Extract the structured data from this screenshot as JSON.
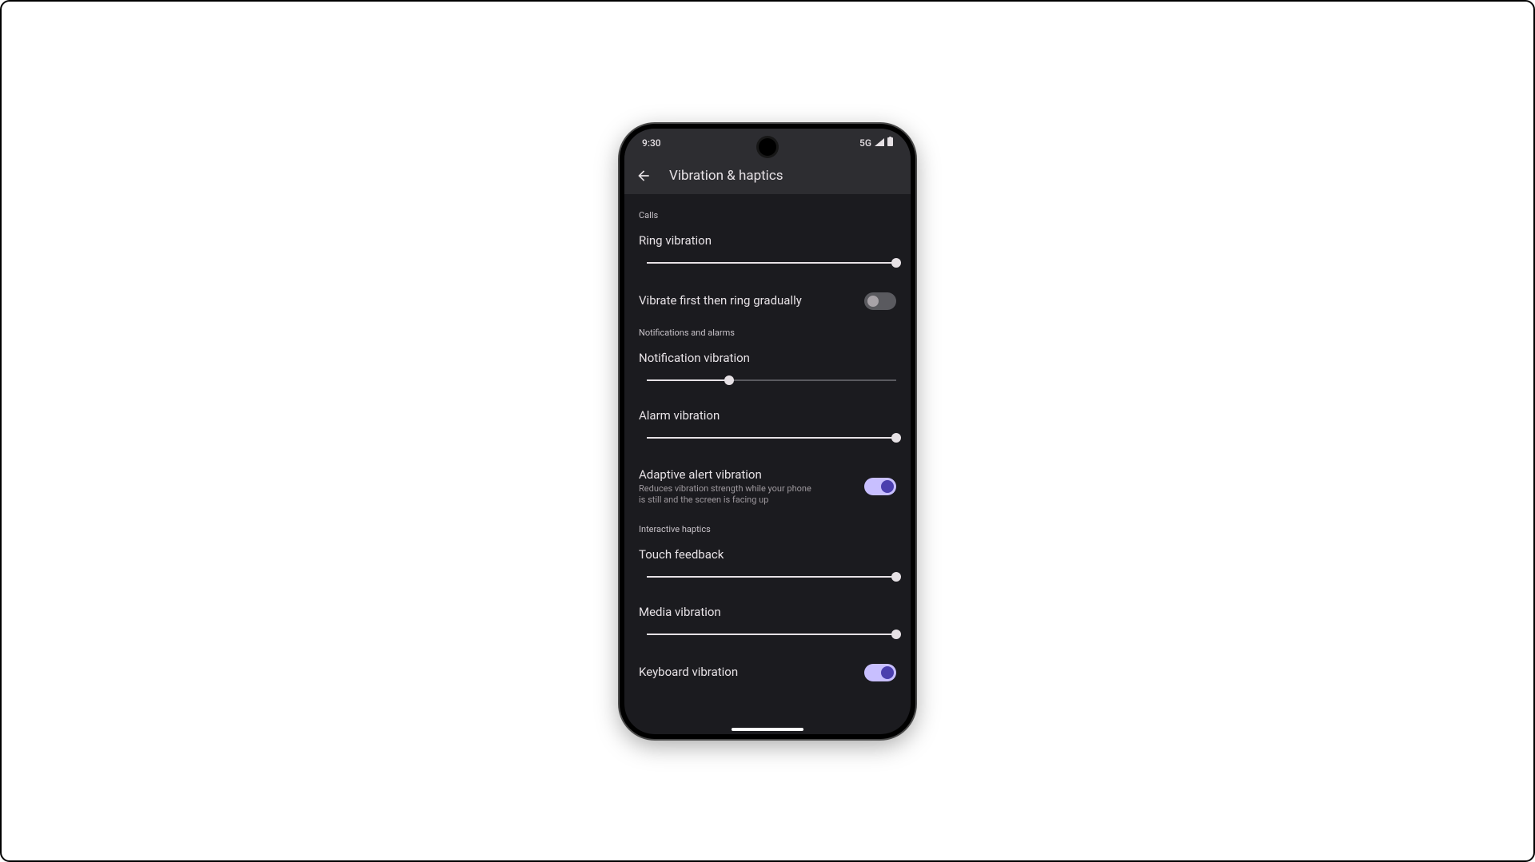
{
  "status": {
    "time": "9:30",
    "network": "5G"
  },
  "header": {
    "title": "Vibration & haptics"
  },
  "sections": {
    "calls": {
      "header": "Calls",
      "ring": {
        "label": "Ring vibration",
        "value": 100
      },
      "vibrate_first": {
        "label": "Vibrate first then ring gradually",
        "enabled": false
      }
    },
    "notifications": {
      "header": "Notifications and alarms",
      "notification": {
        "label": "Notification vibration",
        "value": 33
      },
      "alarm": {
        "label": "Alarm vibration",
        "value": 100
      },
      "adaptive": {
        "label": "Adaptive alert vibration",
        "desc": "Reduces vibration strength while your phone is still and the screen is facing up",
        "enabled": true
      }
    },
    "interactive": {
      "header": "Interactive haptics",
      "touch": {
        "label": "Touch feedback",
        "value": 100
      },
      "media": {
        "label": "Media vibration",
        "value": 100
      },
      "keyboard": {
        "label": "Keyboard vibration",
        "enabled": true
      }
    }
  }
}
